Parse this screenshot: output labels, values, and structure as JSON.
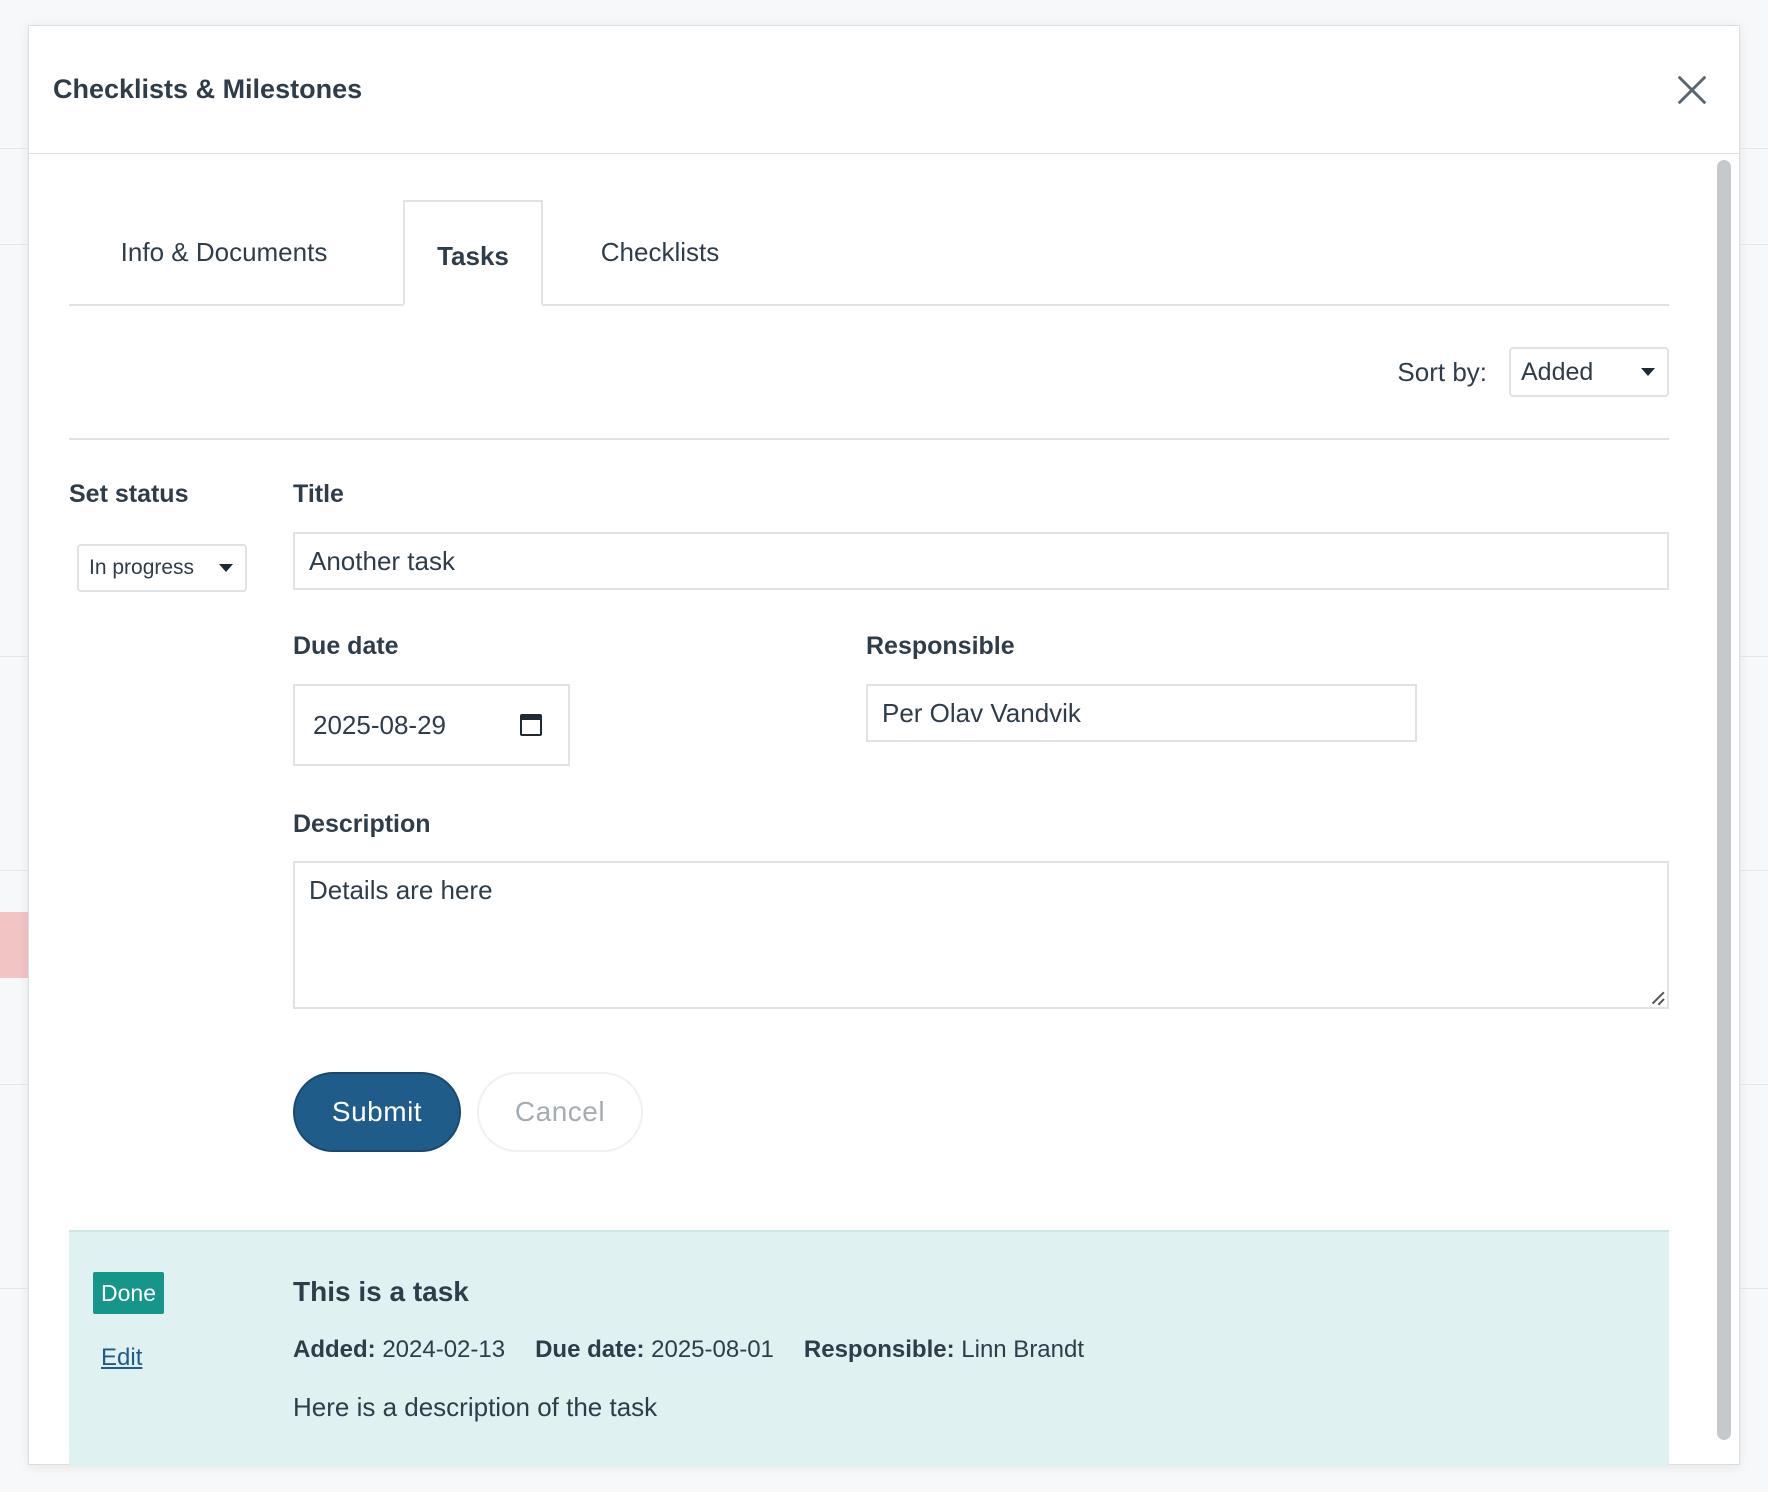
{
  "modal": {
    "title": "Checklists & Milestones"
  },
  "tabs": [
    {
      "label": "Info & Documents",
      "active": false
    },
    {
      "label": "Tasks",
      "active": true
    },
    {
      "label": "Checklists",
      "active": false
    }
  ],
  "sort": {
    "label": "Sort by:",
    "value": "Added"
  },
  "form": {
    "status_label": "Set status",
    "status_value": "In progress",
    "title_label": "Title",
    "title_value": "Another task",
    "due_label": "Due date",
    "due_value": "2025-08-29",
    "responsible_label": "Responsible",
    "responsible_value": "Per Olav Vandvik",
    "description_label": "Description",
    "description_value": "Details are here",
    "submit_label": "Submit",
    "cancel_label": "Cancel"
  },
  "task": {
    "status": "Done",
    "edit_label": "Edit",
    "title": "This is a task",
    "added_label": "Added:",
    "added_value": "2024-02-13",
    "due_label": "Due date:",
    "due_value": "2025-08-01",
    "responsible_label": "Responsible:",
    "responsible_value": "Linn Brandt",
    "description": "Here is a description of the task"
  },
  "colors": {
    "primary": "#1f5c8a",
    "done_badge": "#16958a",
    "task_card_bg": "#e0f1f1"
  }
}
